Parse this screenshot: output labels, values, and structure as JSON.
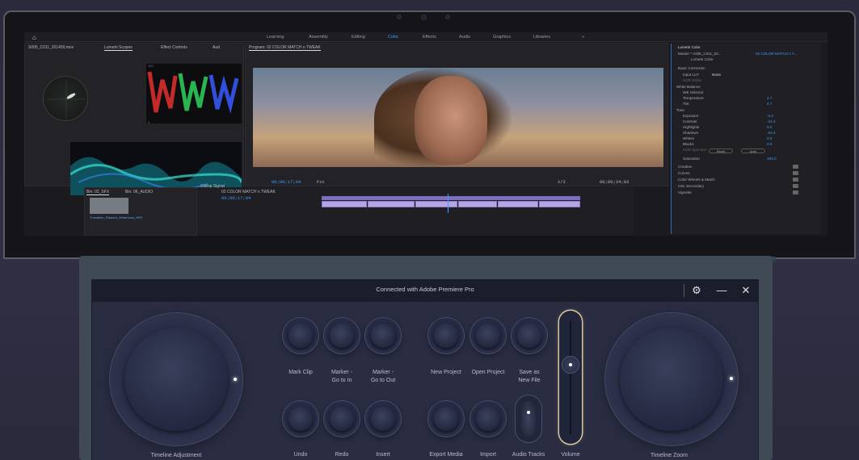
{
  "premiere": {
    "workspaces": [
      "Learning",
      "Assembly",
      "Editing",
      "Color",
      "Effects",
      "Audio",
      "Graphics",
      "Libraries"
    ],
    "active_workspace": "Color",
    "source_panel_tabs": [
      "S005_C011_021450.mov",
      "Lumetri Scopes",
      "Effect Controls",
      "Aud"
    ],
    "program_title": "Program: 02 COLOR MATCH n TWEAK",
    "timecode_current": "00;00;17;04",
    "fit": "Fit",
    "fraction": "1/2",
    "timecode_duration": "00;00;34;03",
    "bin_tabs": [
      "Bin: 02_SFX",
      "Bin: 06_AUDIO"
    ],
    "bin_item": "Transition_Flashed_Whiteness_HFR",
    "clamp_signal": "Clamp Signal",
    "sequence_tab": "02 COLOR MATCH n TWEAK",
    "timeline_timecode": "00;00;17;04",
    "lumetri": {
      "title": "Lumetri Color",
      "master": "Master * A005_C011_02...",
      "clip": "02 COLOR MATCH n T...",
      "fx": "Lumetri Color",
      "sections": {
        "basic": "Basic Correction",
        "input_lut": "Input LUT",
        "input_lut_val": "None",
        "hdr_white": "HDR White",
        "white_balance": "White Balance",
        "wb_selector": "WB Selector",
        "tone": "Tone",
        "reset": "Reset",
        "auto": "Auto",
        "creative": "Creative",
        "curves": "Curves",
        "color_wheels": "Color Wheels & Match",
        "hsl": "HSL Secondary",
        "vignette": "Vignette"
      },
      "rows": [
        {
          "label": "Temperature",
          "value": "4.7"
        },
        {
          "label": "Tint",
          "value": "4.7"
        },
        {
          "label": "Exposure",
          "value": "-0.3"
        },
        {
          "label": "Contrast",
          "value": "-41.4"
        },
        {
          "label": "Highlights",
          "value": "0.0"
        },
        {
          "label": "Shadows",
          "value": "-34.4"
        },
        {
          "label": "Whites",
          "value": "0.0"
        },
        {
          "label": "Blacks",
          "value": "0.0"
        },
        {
          "label": "HDR Specular",
          "value": ""
        }
      ],
      "saturation_label": "Saturation",
      "saturation_value": "100.0"
    }
  },
  "control_panel": {
    "title": "Connected with Adobe Premiere Pro",
    "left_dial": "Timeline Adjustment",
    "right_dial": "Timeline Zoom",
    "buttons_row1": [
      {
        "label": "Mark Clip"
      },
      {
        "label": "Marker -\nGo to In"
      },
      {
        "label": "Marker -\nGo to Out"
      },
      {
        "label": "New Project"
      },
      {
        "label": "Open Project"
      },
      {
        "label": "Save as\nNew File"
      }
    ],
    "buttons_row2": [
      {
        "label": "Undo"
      },
      {
        "label": "Redo"
      },
      {
        "label": "Insert"
      },
      {
        "label": "Export Media"
      },
      {
        "label": "Import"
      }
    ],
    "audio_tracks": "Audio Tracks",
    "volume": "Volume"
  }
}
